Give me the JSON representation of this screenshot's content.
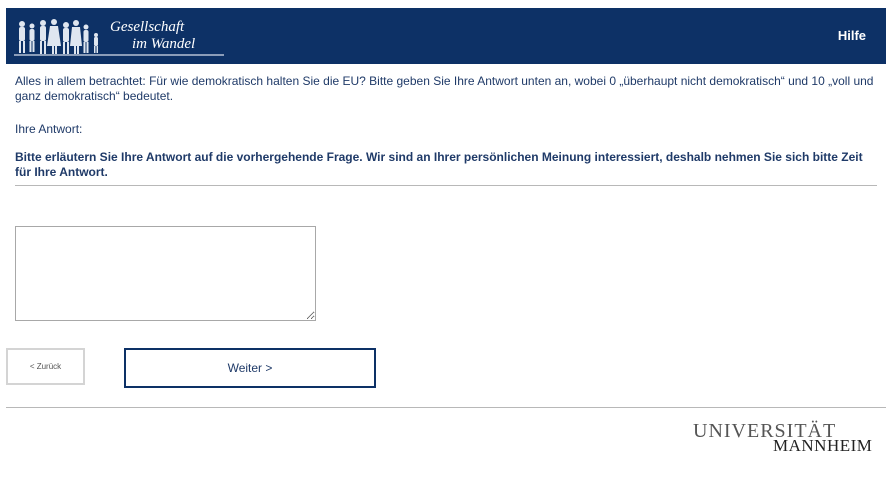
{
  "header": {
    "logo_line1": "Gesellschaft",
    "logo_line2": "im Wandel",
    "help_label": "Hilfe",
    "background_color": "#0d3166"
  },
  "question": {
    "text": "Alles in allem betrachtet: Für wie demokratisch halten Sie die EU? Bitte geben Sie Ihre Antwort unten an, wobei 0 „überhaupt nicht demokratisch“ und 10 „voll und ganz demokratisch“ bedeutet.",
    "answer_label": "Ihre Antwort:"
  },
  "followup": {
    "text": "Bitte erläutern Sie Ihre Antwort auf die vorhergehende Frage. Wir sind an Ihrer persönlichen Meinung interessiert, deshalb nehmen Sie sich bitte Zeit für Ihre Antwort.",
    "answer_value": ""
  },
  "navigation": {
    "back_label": "< Zurück",
    "next_label": "Weiter >"
  },
  "footer": {
    "uni_line1": "UNIVERSITÄT",
    "uni_line2": "MANNHEIM"
  }
}
